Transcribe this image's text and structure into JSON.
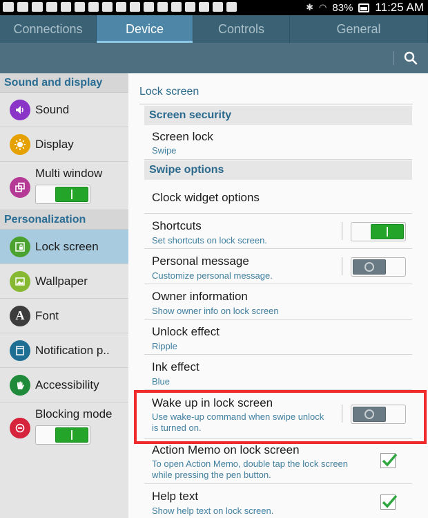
{
  "status": {
    "battery": "83%",
    "time": "11:25 AM"
  },
  "tabs": [
    {
      "label": "Connections"
    },
    {
      "label": "Device"
    },
    {
      "label": "Controls"
    },
    {
      "label": "General"
    }
  ],
  "sidebar": {
    "section1": "Sound and display",
    "section2": "Personalization",
    "items": [
      {
        "label": "Sound",
        "icon": "speaker-icon",
        "color": "#8a35c8"
      },
      {
        "label": "Display",
        "icon": "sun-icon",
        "color": "#e5a100"
      },
      {
        "label": "Multi window",
        "icon": "multi-window-icon",
        "color": "#b53a96",
        "toggle": "on"
      },
      {
        "label": "Lock screen",
        "icon": "lock-screen-icon",
        "color": "#4ca22f"
      },
      {
        "label": "Wallpaper",
        "icon": "wallpaper-icon",
        "color": "#87b832"
      },
      {
        "label": "Font",
        "icon": "font-icon",
        "color": "#3c3c3c",
        "glyph": "A"
      },
      {
        "label": "Notification p..",
        "icon": "notification-panel-icon",
        "color": "#1f6f95"
      },
      {
        "label": "Accessibility",
        "icon": "hand-icon",
        "color": "#1f8a3a"
      },
      {
        "label": "Blocking mode",
        "icon": "blocking-mode-icon",
        "color": "#d6243d",
        "toggle": "on"
      }
    ]
  },
  "content": {
    "title": "Lock screen",
    "section_security": "Screen security",
    "section_swipe": "Swipe options",
    "rows": [
      {
        "title": "Screen lock",
        "sub": "Swipe"
      },
      {
        "title": "Clock widget options"
      },
      {
        "title": "Shortcuts",
        "sub": "Set shortcuts on lock screen.",
        "toggle": "on"
      },
      {
        "title": "Personal message",
        "sub": "Customize personal message.",
        "toggle": "off"
      },
      {
        "title": "Owner information",
        "sub": "Show owner info on lock screen"
      },
      {
        "title": "Unlock effect",
        "sub": "Ripple"
      },
      {
        "title": "Ink effect",
        "sub": "Blue"
      },
      {
        "title": "Wake up in lock screen",
        "sub": "Use wake-up command when swipe unlock",
        "sub2": "is turned on.",
        "toggle": "off"
      },
      {
        "title": "Action Memo on lock screen",
        "sub": "To open Action Memo, double tap the lock screen",
        "sub2": "while pressing the pen button.",
        "checked": true
      },
      {
        "title": "Help text",
        "sub": "Show help text on lock screen.",
        "checked": true
      }
    ]
  },
  "colors": {
    "highlight": "#ef2b2b",
    "accent": "#4d86a6",
    "toggle_on": "#24a52a"
  }
}
